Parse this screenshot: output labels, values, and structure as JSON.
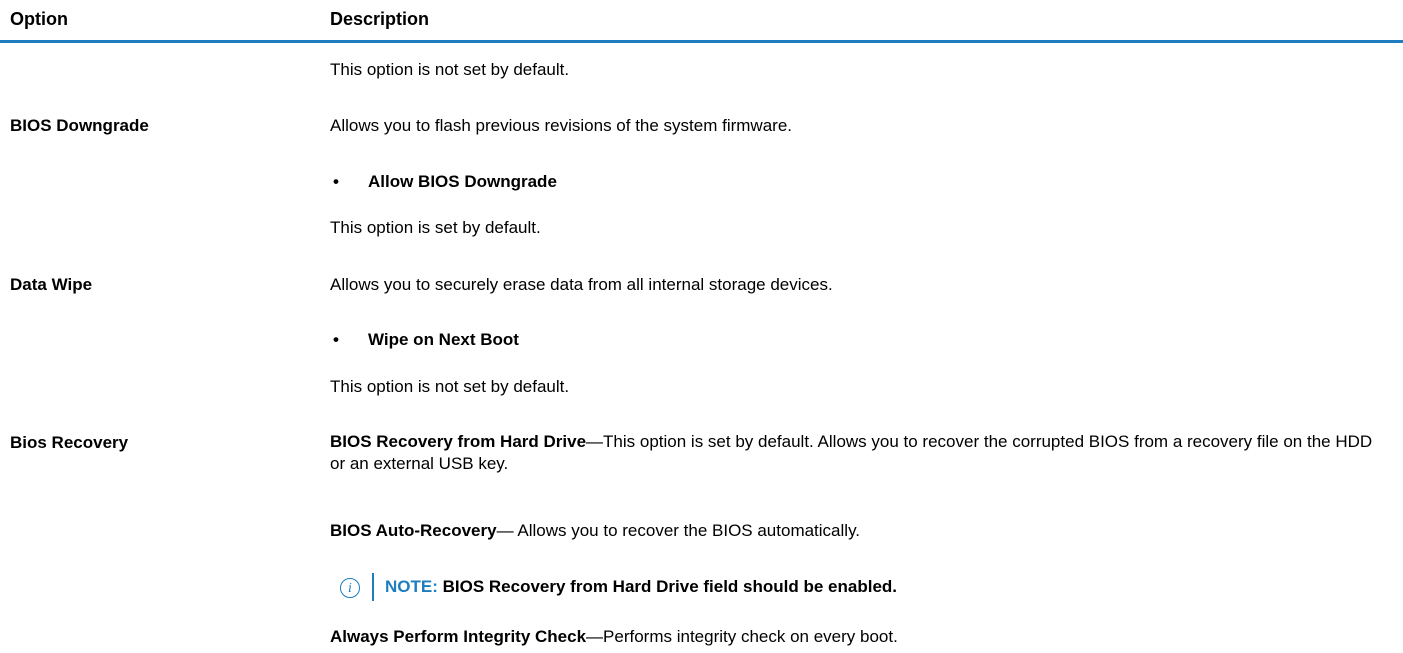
{
  "header": {
    "option": "Option",
    "description": "Description"
  },
  "colors": {
    "accent": "#1d7dbe"
  },
  "rows": {
    "continued": {
      "default_note": "This option is not set by default."
    },
    "bios_downgrade": {
      "option": "BIOS Downgrade",
      "description": "Allows you to flash previous revisions of the system firmware.",
      "bullet": "Allow BIOS Downgrade",
      "default_note": "This option is set by default."
    },
    "data_wipe": {
      "option": "Data Wipe",
      "description": "Allows you to securely erase data from all internal storage devices.",
      "bullet": "Wipe on Next Boot",
      "default_note": "This option is not set by default."
    },
    "bios_recovery": {
      "option": "Bios Recovery",
      "hdd_title": "BIOS Recovery from Hard Drive",
      "hdd_text": "—This option is set by default. Allows you to recover the corrupted BIOS from a recovery file on the HDD or an external USB key.",
      "auto_title": "BIOS Auto-Recovery",
      "auto_text": "— Allows you to recover the BIOS automatically.",
      "note_icon": "info-icon",
      "note_label": "NOTE:",
      "note_text": " BIOS Recovery from Hard Drive field should be enabled.",
      "integrity_title": "Always Perform Integrity Check",
      "integrity_text": "—Performs integrity check on every boot."
    }
  },
  "bullet_char": "•"
}
